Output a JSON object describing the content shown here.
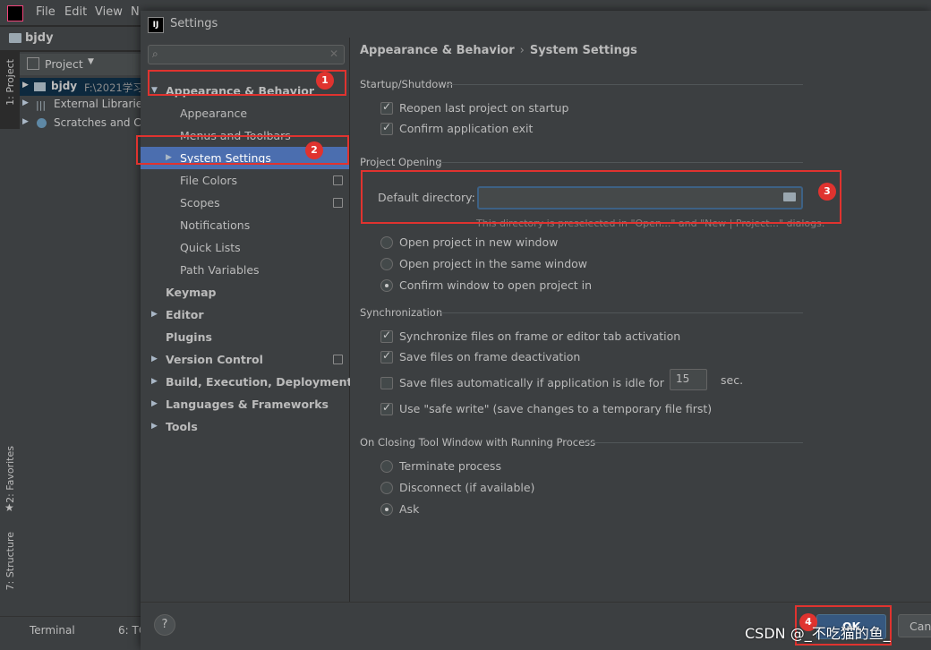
{
  "ide": {
    "menus": [
      "File",
      "Edit",
      "View",
      "N"
    ],
    "project_name": "bjdy",
    "panel_label": "Project",
    "tree": [
      {
        "label": "bjdy",
        "path": "F:\\2021学习"
      },
      {
        "label": "External Librarie"
      },
      {
        "label": "Scratches and C"
      }
    ],
    "side_tabs": {
      "project": "1: Project",
      "favorites": "2: Favorites",
      "structure": "7: Structure"
    },
    "bottom_tabs": {
      "terminal": "Terminal",
      "todo": "6: TO"
    }
  },
  "dialog": {
    "title": "Settings",
    "search": {
      "placeholder": ""
    },
    "nav": [
      {
        "label": "Appearance & Behavior",
        "level": 0,
        "bold": true,
        "expanded": true
      },
      {
        "label": "Appearance",
        "level": 1
      },
      {
        "label": "Menus and Toolbars",
        "level": 1
      },
      {
        "label": "System Settings",
        "level": 1,
        "selected": true,
        "has_children": true
      },
      {
        "label": "File Colors",
        "level": 1,
        "project_icon": true
      },
      {
        "label": "Scopes",
        "level": 1,
        "project_icon": true
      },
      {
        "label": "Notifications",
        "level": 1
      },
      {
        "label": "Quick Lists",
        "level": 1
      },
      {
        "label": "Path Variables",
        "level": 1
      },
      {
        "label": "Keymap",
        "level": 0,
        "bold": true
      },
      {
        "label": "Editor",
        "level": 0,
        "bold": true,
        "has_children": true
      },
      {
        "label": "Plugins",
        "level": 0,
        "bold": true
      },
      {
        "label": "Version Control",
        "level": 0,
        "bold": true,
        "has_children": true,
        "project_icon": true
      },
      {
        "label": "Build, Execution, Deployment",
        "level": 0,
        "bold": true,
        "has_children": true
      },
      {
        "label": "Languages & Frameworks",
        "level": 0,
        "bold": true,
        "has_children": true
      },
      {
        "label": "Tools",
        "level": 0,
        "bold": true,
        "has_children": true
      }
    ],
    "breadcrumb": {
      "parent": "Appearance & Behavior",
      "separator": "›",
      "current": "System Settings"
    },
    "startup": {
      "title": "Startup/Shutdown",
      "reopen_label": "Reopen last project on startup",
      "reopen_checked": true,
      "confirm_exit_label": "Confirm application exit",
      "confirm_exit_checked": true
    },
    "project_opening": {
      "title": "Project Opening",
      "default_dir_label": "Default directory:",
      "default_dir_value": "",
      "hint": "This directory is preselected in \"Open...\" and \"New | Project...\" dialogs.",
      "options": [
        {
          "label": "Open project in new window",
          "checked": false
        },
        {
          "label": "Open project in the same window",
          "checked": false
        },
        {
          "label": "Confirm window to open project in",
          "checked": true
        }
      ]
    },
    "sync": {
      "title": "Synchronization",
      "options": [
        {
          "label": "Synchronize files on frame or editor tab activation",
          "checked": true
        },
        {
          "label": "Save files on frame deactivation",
          "checked": true
        },
        {
          "label": "Save files automatically if application is idle for",
          "checked": false
        },
        {
          "label": "Use \"safe write\" (save changes to a temporary file first)",
          "checked": true
        }
      ],
      "idle_seconds": "15",
      "idle_unit": "sec."
    },
    "closing": {
      "title": "On Closing Tool Window with Running Process",
      "options": [
        {
          "label": "Terminate process",
          "checked": false
        },
        {
          "label": "Disconnect (if available)",
          "checked": false
        },
        {
          "label": "Ask",
          "checked": true
        }
      ]
    },
    "footer": {
      "help": "?",
      "ok": "OK",
      "cancel": "Canc"
    }
  },
  "annotations": {
    "n1": "1",
    "n2": "2",
    "n3": "3",
    "n4": "4"
  },
  "watermark": "CSDN @_不吃猫的鱼_",
  "colors": {
    "selection": "#4b6eaf",
    "annotation": "#e0332f",
    "ok_button": "#365880"
  }
}
